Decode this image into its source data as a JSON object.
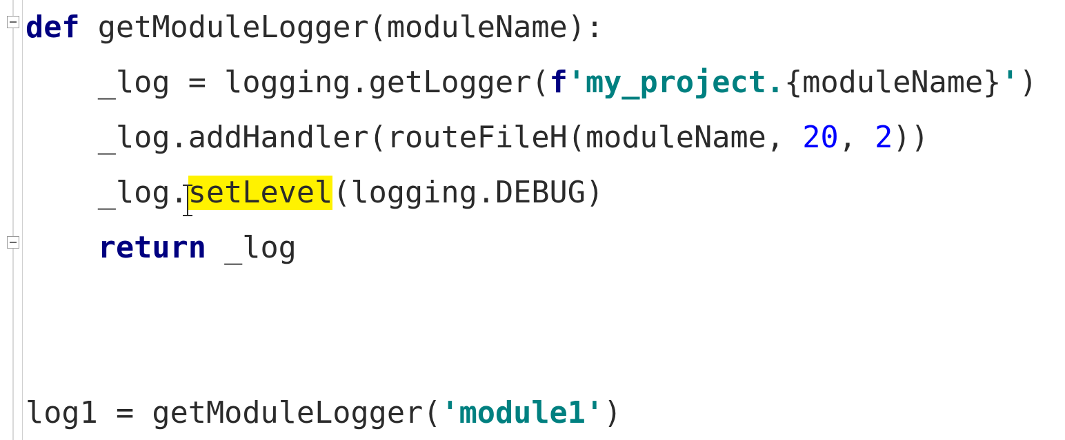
{
  "colors": {
    "keyword": "#000080",
    "string": "#008080",
    "number": "#0000ff",
    "highlight": "#fff200",
    "text": "#2b2b2b",
    "gutter_border": "#cfcfcf"
  },
  "editor": {
    "fold_icons": [
      {
        "line": 1,
        "state": "expanded"
      },
      {
        "line": 5,
        "state": "expanded"
      }
    ],
    "highlighted_token": "setLevel",
    "caret": {
      "line": 4,
      "col_after": "."
    },
    "lines": [
      {
        "indent": 0,
        "tokens": [
          {
            "kind": "kw",
            "text": "def"
          },
          {
            "kind": "sp",
            "text": " "
          },
          {
            "kind": "ident",
            "text": "getModuleLogger"
          },
          {
            "kind": "paren",
            "text": "("
          },
          {
            "kind": "ident",
            "text": "moduleName"
          },
          {
            "kind": "paren",
            "text": ")"
          },
          {
            "kind": "op",
            "text": ":"
          }
        ]
      },
      {
        "indent": 1,
        "tokens": [
          {
            "kind": "ident",
            "text": "_log"
          },
          {
            "kind": "sp",
            "text": " "
          },
          {
            "kind": "op",
            "text": "="
          },
          {
            "kind": "sp",
            "text": " "
          },
          {
            "kind": "ident",
            "text": "logging"
          },
          {
            "kind": "op",
            "text": "."
          },
          {
            "kind": "ident",
            "text": "getLogger"
          },
          {
            "kind": "paren",
            "text": "("
          },
          {
            "kind": "fpre",
            "text": "f"
          },
          {
            "kind": "str",
            "text": "'my_project."
          },
          {
            "kind": "brace",
            "text": "{"
          },
          {
            "kind": "ident",
            "text": "moduleName"
          },
          {
            "kind": "brace",
            "text": "}"
          },
          {
            "kind": "str",
            "text": "'"
          },
          {
            "kind": "paren",
            "text": ")"
          }
        ]
      },
      {
        "indent": 1,
        "tokens": [
          {
            "kind": "ident",
            "text": "_log"
          },
          {
            "kind": "op",
            "text": "."
          },
          {
            "kind": "ident",
            "text": "addHandler"
          },
          {
            "kind": "paren",
            "text": "("
          },
          {
            "kind": "ident",
            "text": "routeFileH"
          },
          {
            "kind": "paren",
            "text": "("
          },
          {
            "kind": "ident",
            "text": "moduleName"
          },
          {
            "kind": "op",
            "text": ","
          },
          {
            "kind": "sp",
            "text": " "
          },
          {
            "kind": "num",
            "text": "20"
          },
          {
            "kind": "op",
            "text": ","
          },
          {
            "kind": "sp",
            "text": " "
          },
          {
            "kind": "num",
            "text": "2"
          },
          {
            "kind": "paren",
            "text": ")"
          },
          {
            "kind": "paren",
            "text": ")"
          }
        ]
      },
      {
        "indent": 1,
        "tokens": [
          {
            "kind": "ident",
            "text": "_log"
          },
          {
            "kind": "op",
            "text": "."
          },
          {
            "kind": "ident",
            "text": "setLevel",
            "highlight": true
          },
          {
            "kind": "paren",
            "text": "("
          },
          {
            "kind": "ident",
            "text": "logging"
          },
          {
            "kind": "op",
            "text": "."
          },
          {
            "kind": "ident",
            "text": "DEBUG"
          },
          {
            "kind": "paren",
            "text": ")"
          }
        ]
      },
      {
        "indent": 1,
        "tokens": [
          {
            "kind": "kw",
            "text": "return"
          },
          {
            "kind": "sp",
            "text": " "
          },
          {
            "kind": "ident",
            "text": "_log"
          }
        ]
      },
      {
        "indent": 0,
        "tokens": []
      },
      {
        "indent": 0,
        "tokens": []
      },
      {
        "indent": 0,
        "tokens": [
          {
            "kind": "ident",
            "text": "log1"
          },
          {
            "kind": "sp",
            "text": " "
          },
          {
            "kind": "op",
            "text": "="
          },
          {
            "kind": "sp",
            "text": " "
          },
          {
            "kind": "ident",
            "text": "getModuleLogger"
          },
          {
            "kind": "paren",
            "text": "("
          },
          {
            "kind": "str",
            "text": "'module1'"
          },
          {
            "kind": "paren",
            "text": ")"
          }
        ]
      }
    ]
  }
}
